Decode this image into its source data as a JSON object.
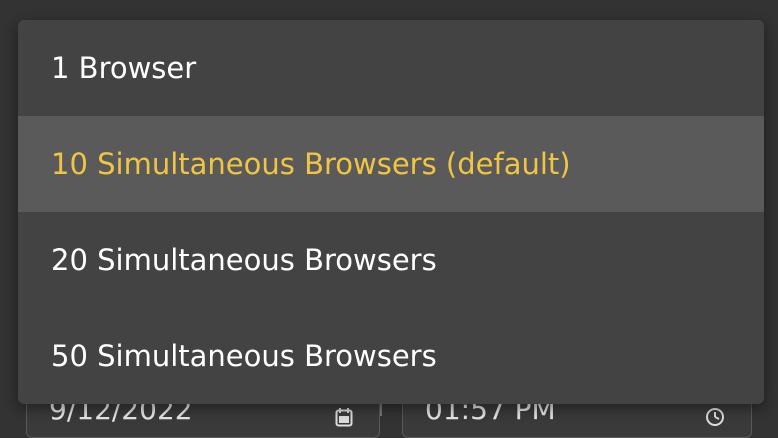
{
  "dropdown": {
    "options": [
      {
        "label": "1 Browser"
      },
      {
        "label": "10 Simultaneous Browsers (default)"
      },
      {
        "label": "20 Simultaneous Browsers"
      },
      {
        "label": "50 Simultaneous Browsers"
      }
    ],
    "selected_index": 1
  },
  "form": {
    "date_value": "9/12/2022",
    "time_value": "01:57 PM"
  },
  "icons": {
    "date": "calendar-icon",
    "time": "clock-icon"
  },
  "colors": {
    "menu_background": "#434343",
    "selected_background": "#5a5a5a",
    "selected_text": "#f0c543",
    "text": "#ffffff"
  }
}
